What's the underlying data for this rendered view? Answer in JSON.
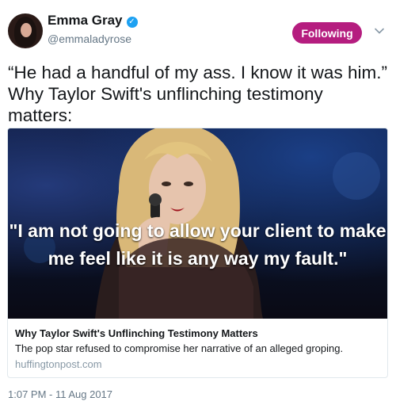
{
  "author": {
    "name": "Emma Gray",
    "handle": "@emmaladyrose",
    "verified_icon": "verified-badge-icon"
  },
  "follow_button": {
    "label": "Following",
    "color": "#b51d7f"
  },
  "menu": {
    "icon": "chevron-down-icon"
  },
  "tweet": {
    "text": "“He had a handful of my ass. I know it was him.” Why Taylor Swift's unflinching testimony matters:"
  },
  "card": {
    "image_quote": "\"I am not going to allow your client to make me feel like it is any way my fault.\"",
    "title": "Why Taylor Swift's Unflinching Testimony Matters",
    "description": "The pop star refused to compromise her narrative of an alleged groping.",
    "domain": "huffingtonpost.com"
  },
  "timestamp": "1:07 PM - 11 Aug 2017",
  "colors": {
    "accent": "#1da1f2",
    "text": "#14171a",
    "muted": "#657786"
  }
}
